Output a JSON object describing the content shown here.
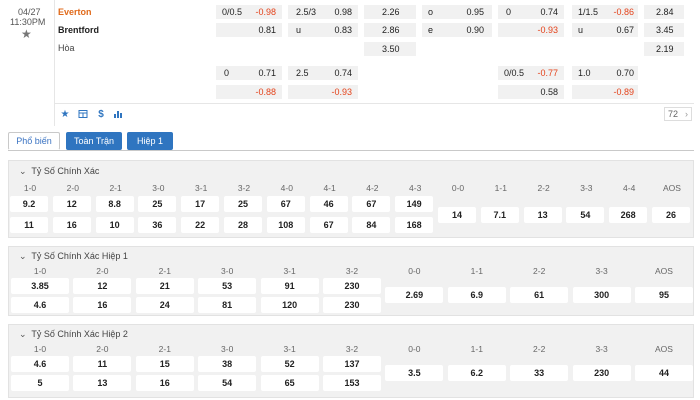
{
  "match": {
    "date": "04/27",
    "time": "11:30PM",
    "home": "Everton",
    "away": "Brentford",
    "draw": "Hòa",
    "count": "72"
  },
  "odds": {
    "r1": {
      "a_line": "0/0.5",
      "a_val": "-0.98",
      "b_line": "2.5/3",
      "b_val": "0.98",
      "c": "2.26",
      "d_lbl": "o",
      "d_val": "0.95",
      "e_line": "0",
      "e_val": "0.74",
      "f_line": "1/1.5",
      "f_val": "-0.86",
      "g": "2.84"
    },
    "r2": {
      "a_val": "0.81",
      "b_lbl": "u",
      "b_val": "0.83",
      "c": "2.86",
      "d_lbl": "e",
      "d_val": "0.90",
      "e_val": "-0.93",
      "f_lbl": "u",
      "f_val": "0.67",
      "g": "3.45"
    },
    "r3": {
      "c": "3.50",
      "g": "2.19"
    },
    "r4": {
      "a_line": "0",
      "a_val": "0.71",
      "b_line": "2.5",
      "b_val": "0.74",
      "e_line": "0/0.5",
      "e_val": "-0.77",
      "f_line": "1.0",
      "f_val": "0.70"
    },
    "r5": {
      "a_val": "-0.88",
      "b_val": "-0.93",
      "e_val": "0.58",
      "f_val": "-0.89"
    }
  },
  "tabs": {
    "popular": "Phổ biến",
    "full": "Toàn Trận",
    "half1": "Hiệp 1"
  },
  "sections": [
    {
      "title": "Tỷ Số Chính Xác",
      "headers": [
        "1-0",
        "2-0",
        "2-1",
        "3-0",
        "3-1",
        "3-2",
        "4-0",
        "4-1",
        "4-2",
        "4-3",
        "0-0",
        "1-1",
        "2-2",
        "3-3",
        "4-4",
        "AOS"
      ],
      "row1": [
        "9.2",
        "12",
        "8.8",
        "25",
        "17",
        "25",
        "67",
        "46",
        "67",
        "149"
      ],
      "row2": [
        "11",
        "16",
        "10",
        "36",
        "22",
        "28",
        "108",
        "67",
        "84",
        "168"
      ],
      "draws": [
        "14",
        "7.1",
        "13",
        "54",
        "268",
        "26"
      ]
    },
    {
      "title": "Tỷ Số Chính Xác Hiệp 1",
      "headers": [
        "1-0",
        "2-0",
        "2-1",
        "3-0",
        "3-1",
        "3-2",
        "0-0",
        "1-1",
        "2-2",
        "3-3",
        "AOS"
      ],
      "row1": [
        "3.85",
        "12",
        "21",
        "53",
        "91",
        "230"
      ],
      "row2": [
        "4.6",
        "16",
        "24",
        "81",
        "120",
        "230"
      ],
      "draws": [
        "2.69",
        "6.9",
        "61",
        "300",
        "95"
      ]
    },
    {
      "title": "Tỷ Số Chính Xác Hiệp 2",
      "headers": [
        "1-0",
        "2-0",
        "2-1",
        "3-0",
        "3-1",
        "3-2",
        "0-0",
        "1-1",
        "2-2",
        "3-3",
        "AOS"
      ],
      "row1": [
        "4.6",
        "11",
        "15",
        "38",
        "52",
        "137"
      ],
      "row2": [
        "5",
        "13",
        "16",
        "54",
        "65",
        "153"
      ],
      "draws": [
        "3.5",
        "6.2",
        "33",
        "230",
        "44"
      ]
    }
  ],
  "colors": {
    "accent": "#2f75c0",
    "negative": "#e4421a",
    "home": "#e06a1b"
  }
}
